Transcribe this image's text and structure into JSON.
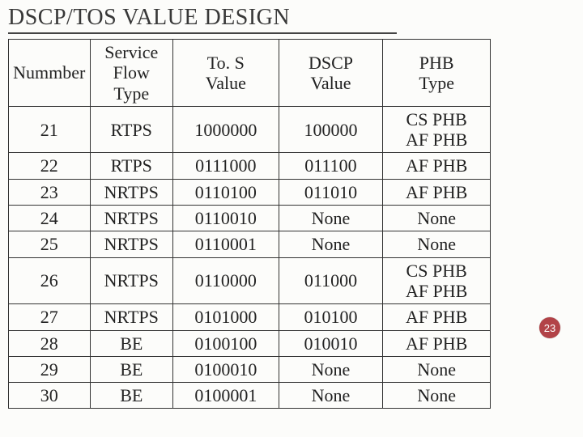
{
  "title": "DSCP/TOS VALUE DESIGN",
  "page_number": "23",
  "table": {
    "headers": {
      "c1": "Nummber",
      "c2": "Service\nFlow\nType",
      "c3": "To. S\nValue",
      "c4": "DSCP\nValue",
      "c5": "PHB\nType"
    },
    "rows": [
      {
        "c1": "21",
        "c2": "RTPS",
        "c3": "1000000",
        "c4": "100000",
        "c5": "CS PHB\nAF PHB"
      },
      {
        "c1": "22",
        "c2": "RTPS",
        "c3": "0111000",
        "c4": "011100",
        "c5": "AF PHB"
      },
      {
        "c1": "23",
        "c2": "NRTPS",
        "c3": "0110100",
        "c4": "011010",
        "c5": "AF PHB"
      },
      {
        "c1": "24",
        "c2": "NRTPS",
        "c3": "0110010",
        "c4": "None",
        "c5": "None"
      },
      {
        "c1": "25",
        "c2": "NRTPS",
        "c3": "0110001",
        "c4": "None",
        "c5": "None"
      },
      {
        "c1": "26",
        "c2": "NRTPS",
        "c3": "0110000",
        "c4": "011000",
        "c5": "CS PHB\nAF PHB"
      },
      {
        "c1": "27",
        "c2": "NRTPS",
        "c3": "0101000",
        "c4": "010100",
        "c5": "AF PHB"
      },
      {
        "c1": "28",
        "c2": "BE",
        "c3": "0100100",
        "c4": "010010",
        "c5": "AF PHB"
      },
      {
        "c1": "29",
        "c2": "BE",
        "c3": "0100010",
        "c4": "None",
        "c5": "None"
      },
      {
        "c1": "30",
        "c2": "BE",
        "c3": "0100001",
        "c4": "None",
        "c5": "None"
      }
    ]
  }
}
